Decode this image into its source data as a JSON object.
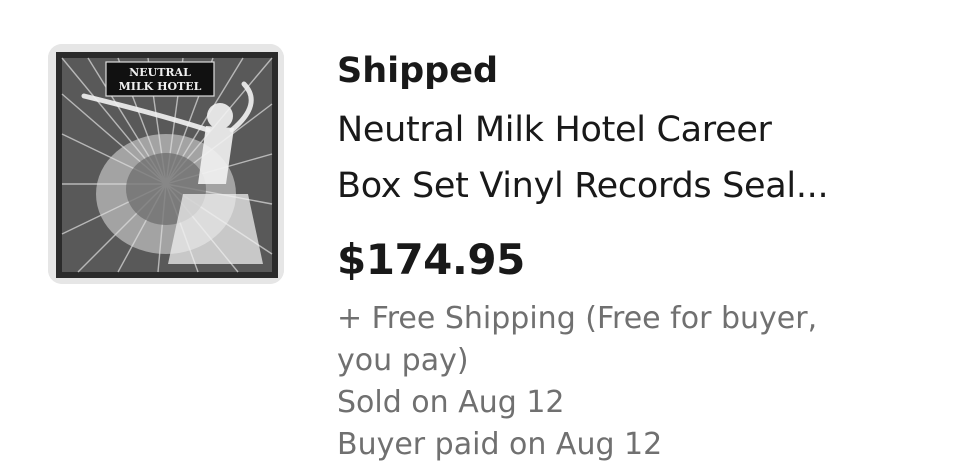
{
  "order": {
    "status": "Shipped",
    "title_line1": "Neutral Milk Hotel Career",
    "title_line2": "Box Set Vinyl Records Seal...",
    "price": "$174.95",
    "shipping_line1": "+ Free Shipping (Free for buyer,",
    "shipping_line2": "you pay)",
    "sold_on": "Sold on Aug 12",
    "buyer_paid": "Buyer paid on Aug 12",
    "image": {
      "label_line1": "NEUTRAL",
      "label_line2": "MILK HOTEL",
      "icon": "album-cover-image"
    }
  },
  "colors": {
    "primary_text": "#191919",
    "secondary_text": "#707070",
    "background": "#ffffff"
  }
}
